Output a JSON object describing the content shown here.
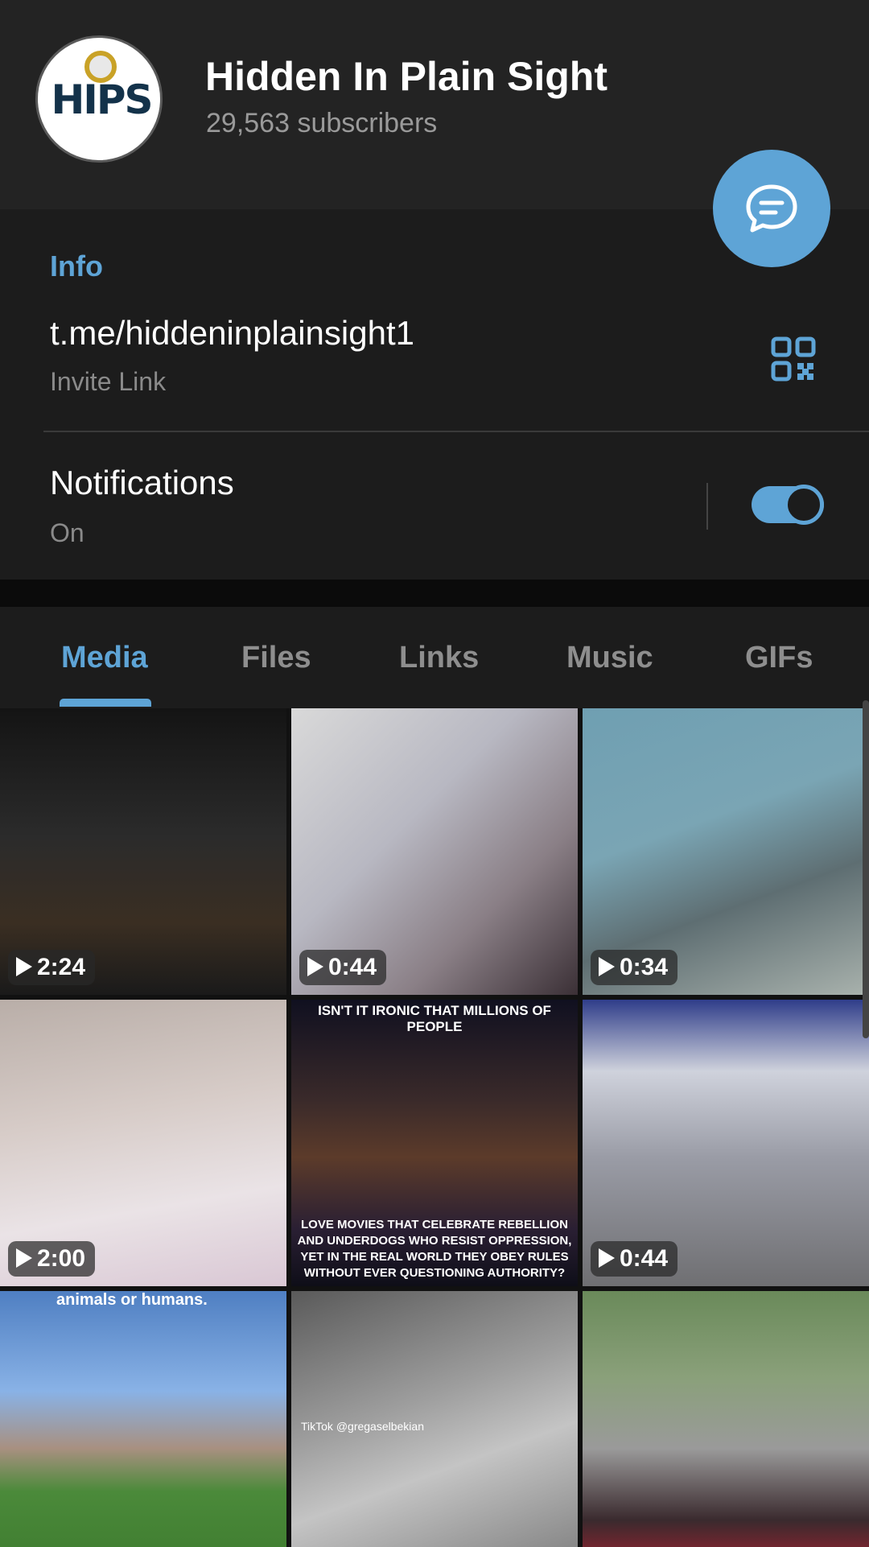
{
  "channel": {
    "title": "Hidden In Plain Sight",
    "subscribers": "29,563 subscribers",
    "avatar_text": "HIPS"
  },
  "info": {
    "section_label": "Info",
    "link": "t.me/hiddeninplainsight1",
    "link_caption": "Invite Link",
    "notifications_label": "Notifications",
    "notifications_status": "On"
  },
  "tabs": [
    {
      "label": "Media",
      "active": true
    },
    {
      "label": "Files",
      "active": false
    },
    {
      "label": "Links",
      "active": false
    },
    {
      "label": "Music",
      "active": false
    },
    {
      "label": "GIFs",
      "active": false
    }
  ],
  "media": [
    {
      "duration": "2:24"
    },
    {
      "duration": "0:44"
    },
    {
      "duration": "0:34"
    },
    {
      "duration": "2:00"
    },
    {
      "duration": "",
      "caption_top": "ISN'T IT IRONIC THAT MILLIONS OF PEOPLE",
      "caption_bottom": "LOVE MOVIES THAT CELEBRATE REBELLION AND UNDERDOGS WHO RESIST OPPRESSION, YET IN THE REAL WORLD THEY OBEY RULES WITHOUT EVER QUESTIONING AUTHORITY?"
    },
    {
      "duration": "0:44"
    },
    {
      "duration": "",
      "caption_top": "animals or humans."
    },
    {
      "duration": "",
      "tiktok": "TikTok @gregaselbekian"
    },
    {
      "duration": ""
    }
  ],
  "colors": {
    "accent": "#5ea4d6",
    "background": "#1c1c1c",
    "header": "#232323"
  },
  "icons": {
    "fab": "chat-bubble-icon",
    "qr": "qr-code-icon",
    "play": "play-icon"
  }
}
